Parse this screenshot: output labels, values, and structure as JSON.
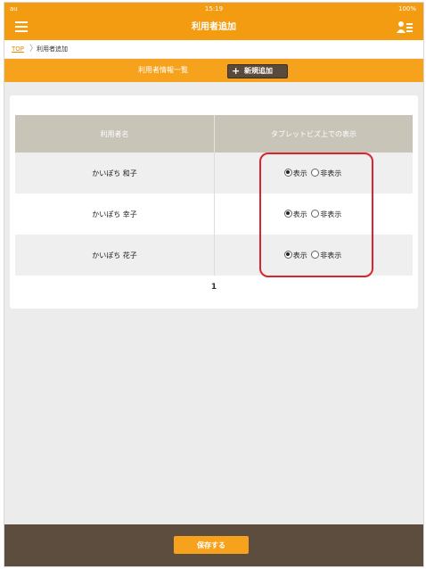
{
  "statusbar": {
    "carrier": "au",
    "time": "15:19",
    "battery": "100%"
  },
  "header": {
    "title": "利用者追加"
  },
  "breadcrumb": {
    "top": "TOP",
    "current": "利用者追加"
  },
  "section": {
    "title": "利用者情報一覧",
    "add_button": "新規追加"
  },
  "table": {
    "headers": [
      "利用者名",
      "タブレットビズ上での表示"
    ],
    "rows": [
      {
        "name": "かいぽち 和子",
        "show": "表示",
        "hide": "非表示",
        "selected": "show"
      },
      {
        "name": "かいぽち 幸子",
        "show": "表示",
        "hide": "非表示",
        "selected": "show"
      },
      {
        "name": "かいぽち 花子",
        "show": "表示",
        "hide": "非表示",
        "selected": "show"
      }
    ]
  },
  "pagination": {
    "current": "1"
  },
  "footer": {
    "save_button": "保存する"
  },
  "colors": {
    "accent": "#f39c12",
    "footer": "#5d4d3f",
    "highlight": "#d9252b"
  }
}
